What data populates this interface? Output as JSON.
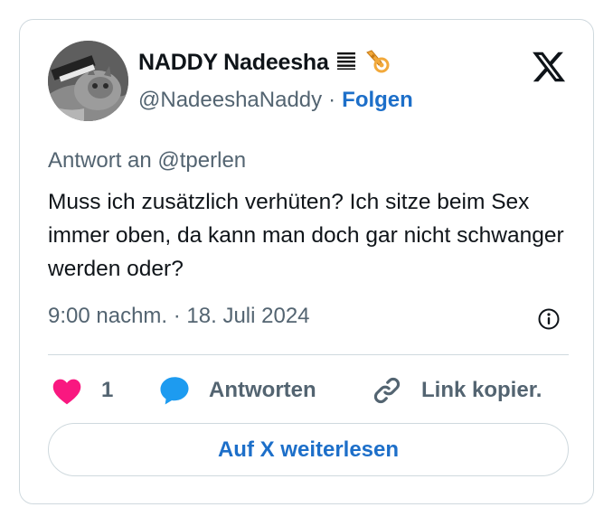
{
  "author": {
    "name": "NADDY Nadeesha",
    "name_emojis": [
      "notepad-lines-emoji",
      "trumpet-emoji"
    ],
    "handle": "@NadeeshaNaddy",
    "separator": "·",
    "follow_label": "Folgen",
    "avatar_icon": "cat-photo-avatar"
  },
  "tweet": {
    "reply_to": "Antwort an @tperlen",
    "text": "Muss ich zusätzlich verhüten? Ich sitze beim Sex immer oben, da kann man doch gar nicht schwanger werden oder?",
    "timestamp": "9:00 nachm. · 18. Juli 2024"
  },
  "actions": {
    "like_count": "1",
    "reply_label": "Antworten",
    "copy_link_label": "Link kopier."
  },
  "read_more_label": "Auf X weiterlesen",
  "colors": {
    "link_blue": "#1d6fc9",
    "heart_pink": "#f91880",
    "reply_blue": "#1d9bf0",
    "muted_gray": "#536471",
    "border": "#cfd9de",
    "text": "#0f1419"
  }
}
